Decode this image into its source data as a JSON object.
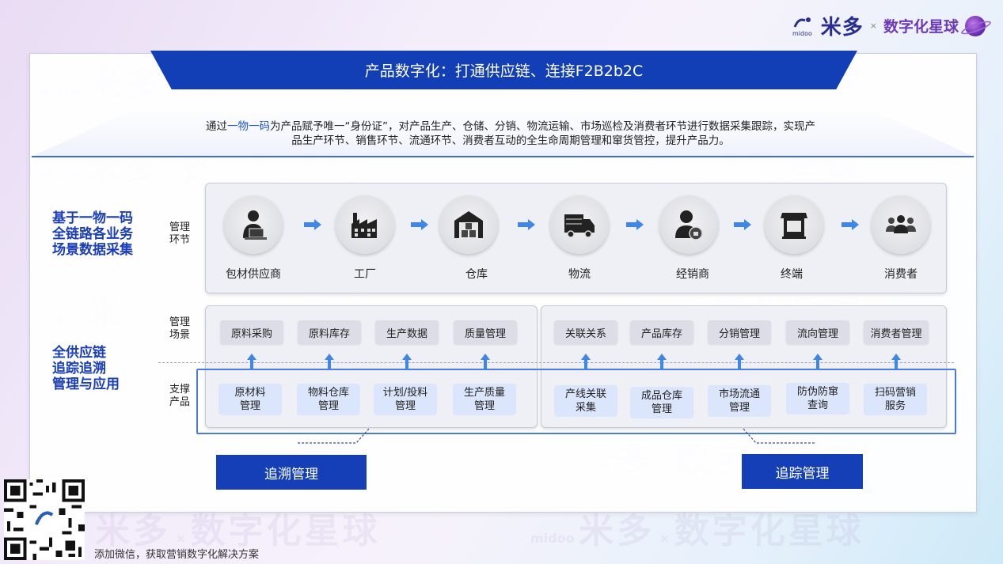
{
  "brand": {
    "midoo_text": "米多",
    "midoo_small": "midoo",
    "times": "×",
    "planet_text": "数字化星球"
  },
  "title": "产品数字化：打通供应链、连接F2B2b2C",
  "intro": {
    "prefix": "通过",
    "highlight": "一物一码",
    "line1_rest": "为产品赋予唯一“身份证”，对产品生产、仓储、分销、物流运输、市场巡检及消费者环节进行数据采集跟踪，实现产",
    "line2": "品生产环节、销售环节、流通环节、消费者互动的全生命周期管理和窜货管控，提升产品力。"
  },
  "side_headings": {
    "top": [
      "基于一物一码",
      "全链路各业务",
      "场景数据采集"
    ],
    "bottom": [
      "全供应链",
      "追踪追溯",
      "管理与应用"
    ]
  },
  "row_labels": {
    "mgmt_link": [
      "管理",
      "环节"
    ],
    "mgmt_scene": [
      "管理",
      "场景"
    ],
    "support": [
      "支撑",
      "产品"
    ]
  },
  "stages": [
    {
      "label": "包材供应商",
      "icon": "supplier-icon"
    },
    {
      "label": "工厂",
      "icon": "factory-icon"
    },
    {
      "label": "仓库",
      "icon": "warehouse-icon"
    },
    {
      "label": "物流",
      "icon": "truck-icon"
    },
    {
      "label": "经销商",
      "icon": "dealer-icon"
    },
    {
      "label": "终端",
      "icon": "store-icon"
    },
    {
      "label": "消费者",
      "icon": "consumers-icon"
    }
  ],
  "scenes_left": [
    "原料采购",
    "原料库存",
    "生产数据",
    "质量管理"
  ],
  "scenes_right": [
    "关联关系",
    "产品库存",
    "分销管理",
    "流向管理",
    "消费者管理"
  ],
  "support_left": [
    "原材料\n管理",
    "物料仓库\n管理",
    "计划/投料\n管理",
    "生产质量\n管理"
  ],
  "support_right": [
    "产线关联\n采集",
    "成品仓库\n管理",
    "市场流通\n管理",
    "防伪防窜\n查询",
    "扫码营销\n服务"
  ],
  "trace_back": "追溯管理",
  "trace_forward": "追踪管理",
  "footer": "添加微信，获取营销数字化解决方案",
  "colors": {
    "primary": "#133fb6",
    "accent": "#3f86ea",
    "heading": "#1a3eb8"
  }
}
